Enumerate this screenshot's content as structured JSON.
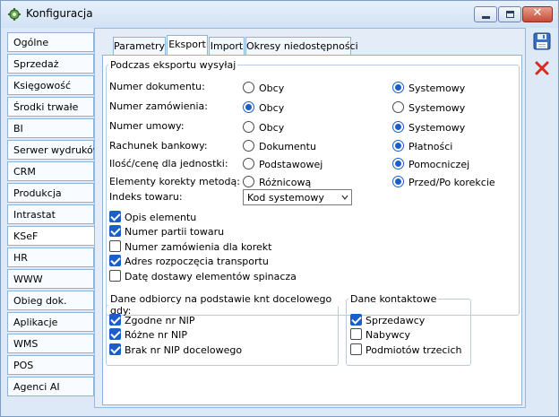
{
  "window": {
    "title": "Konfiguracja"
  },
  "sidebar": {
    "items": [
      {
        "label": "Ogólne"
      },
      {
        "label": "Sprzedaż"
      },
      {
        "label": "Księgowość"
      },
      {
        "label": "Środki trwałe"
      },
      {
        "label": "BI"
      },
      {
        "label": "Serwer wydruków"
      },
      {
        "label": "CRM"
      },
      {
        "label": "Produkcja"
      },
      {
        "label": "Intrastat"
      },
      {
        "label": "KSeF"
      },
      {
        "label": "HR"
      },
      {
        "label": "WWW"
      },
      {
        "label": "Obieg dok."
      },
      {
        "label": "Aplikacje"
      },
      {
        "label": "WMS"
      },
      {
        "label": "POS"
      },
      {
        "label": "Agenci AI"
      }
    ],
    "active": "KSeF"
  },
  "tabs": [
    {
      "label": "Parametry"
    },
    {
      "label": "Eksport"
    },
    {
      "label": "Import"
    },
    {
      "label": "Okresy niedostępności"
    }
  ],
  "active_tab": "Eksport",
  "export": {
    "legend": "Podczas eksportu wysyłaj",
    "rows": [
      {
        "label": "Numer dokumentu:",
        "opt1": "Obcy",
        "opt2": "Systemowy",
        "selected": 2
      },
      {
        "label": "Numer zamówienia:",
        "opt1": "Obcy",
        "opt2": "Systemowy",
        "selected": 1
      },
      {
        "label": "Numer umowy:",
        "opt1": "Obcy",
        "opt2": "Systemowy",
        "selected": 2
      },
      {
        "label": "Rachunek bankowy:",
        "opt1": "Dokumentu",
        "opt2": "Płatności",
        "selected": 2
      },
      {
        "label": "Ilość/cenę dla jednostki:",
        "opt1": "Podstawowej",
        "opt2": "Pomocniczej",
        "selected": 2
      },
      {
        "label": "Elementy korekty metodą:",
        "opt1": "Różnicową",
        "opt2": "Przed/Po korekcie",
        "selected": 2
      }
    ],
    "index_label": "Indeks towaru:",
    "index_value": "Kod systemowy",
    "checks": [
      {
        "label": "Opis elementu",
        "checked": true
      },
      {
        "label": "Numer partii towaru",
        "checked": true
      },
      {
        "label": "Numer zamówienia dla korekt",
        "checked": false
      },
      {
        "label": "Adres rozpoczęcia transportu",
        "checked": true
      },
      {
        "label": "Datę dostawy elementów spinacza",
        "checked": false
      }
    ]
  },
  "recipient": {
    "legend": "Dane odbiorcy na podstawie knt docelowego gdy:",
    "checks": [
      {
        "label": "Zgodne nr NIP",
        "checked": true
      },
      {
        "label": "Różne nr NIP",
        "checked": true
      },
      {
        "label": "Brak nr NIP docelowego",
        "checked": true
      }
    ]
  },
  "contact": {
    "legend": "Dane kontaktowe",
    "checks": [
      {
        "label": "Sprzedawcy",
        "checked": true
      },
      {
        "label": "Nabywcy",
        "checked": false
      },
      {
        "label": "Podmiotów trzecich",
        "checked": false
      }
    ]
  },
  "colors": {
    "accent": "#1a5fc9",
    "window_bg": "#dde9f7",
    "close_red": "#c44b36"
  },
  "toolbar": {
    "save_icon": "floppy-disk-icon",
    "cancel_icon": "red-x-icon"
  }
}
